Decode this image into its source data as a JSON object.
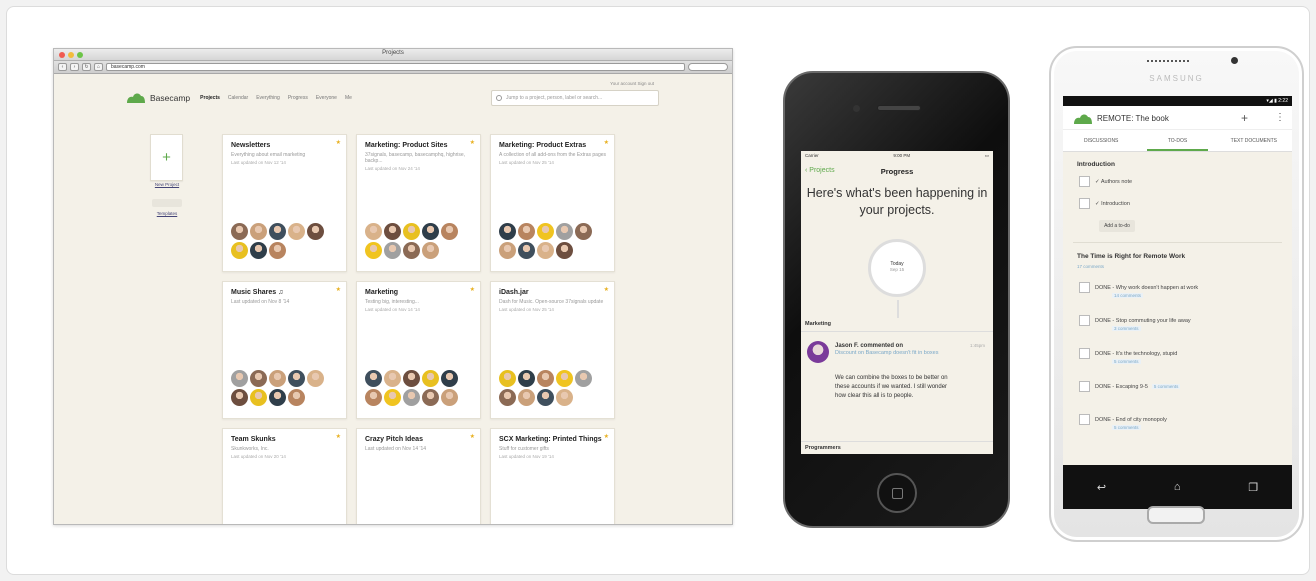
{
  "desktop": {
    "window_title": "Projects",
    "url": "basecamp.com",
    "top_links": "Your account   Sign out",
    "app_name": "Basecamp",
    "nav": [
      {
        "label": "Projects",
        "active": true
      },
      {
        "label": "Calendar",
        "active": false
      },
      {
        "label": "Everything",
        "active": false
      },
      {
        "label": "Progress",
        "active": false
      },
      {
        "label": "Everyone",
        "active": false
      },
      {
        "label": "Me",
        "active": false
      }
    ],
    "search_placeholder": "Jump to a project, person, label or search...",
    "new_project_label": "New Project",
    "templates_label": "Templates",
    "cards": [
      {
        "title": "Newsletters",
        "desc": "Everything about email marketing",
        "updated": "Last updated on Nov 12 '14",
        "avatars": 8
      },
      {
        "title": "Marketing: Product Sites",
        "desc": "37signals, basecamp, basecamphq, highrise, backp...",
        "updated": "Last updated on Nov 24 '14",
        "avatars": 9
      },
      {
        "title": "Marketing: Product Extras",
        "desc": "A collection of all add-ons from the Extras pages",
        "updated": "Last updated on Nov 25 '14",
        "avatars": 9
      },
      {
        "title": "Music Shares ♫",
        "desc": "Last updated on Nov 8 '14",
        "updated": "",
        "avatars": 9
      },
      {
        "title": "Marketing",
        "desc": "Testing big, interesting...",
        "updated": "Last updated on Nov 14 '14",
        "avatars": 10
      },
      {
        "title": "iDash.jar",
        "desc": "Dash for Music. Open-source 37signals update",
        "updated": "Last updated on Nov 25 '14",
        "avatars": 9
      },
      {
        "title": "Team Skunks",
        "desc": "Skunkworks, Inc.",
        "updated": "Last updated on Nov 20 '14",
        "avatars": 0
      },
      {
        "title": "Crazy Pitch Ideas",
        "desc": "Last updated on Nov 14 '14",
        "updated": "",
        "avatars": 0
      },
      {
        "title": "SCX Marketing: Printed Things",
        "desc": "Stuff for customer gifts",
        "updated": "Last updated on Nov 19 '14",
        "avatars": 0
      }
    ]
  },
  "iphone": {
    "carrier": "Carrier",
    "time": "9:00 PM",
    "back_label": "Projects",
    "title": "Progress",
    "headline": "Here's what's been happening in your projects.",
    "today_label": "Today",
    "today_date": "Sep 15",
    "section_1": "Marketing",
    "comment_author": "Jason F. commented on",
    "comment_time": "1:45pm",
    "comment_link": "Discount on Basecamp doesn't fit in boxes",
    "comment_body": "We can combine the boxes to be better on these accounts if we wanted. I still wonder how clear this all is to people.",
    "section_2": "Programmers"
  },
  "samsung": {
    "brand": "SAMSUNG",
    "time": "2:22",
    "title": "REMOTE: The book",
    "tabs": [
      {
        "label": "DISCUSSIONS",
        "active": false
      },
      {
        "label": "TO-DOS",
        "active": true
      },
      {
        "label": "TEXT DOCUMENTS",
        "active": false
      }
    ],
    "list_1_title": "Introduction",
    "list_1_items": [
      "Authors note",
      "Introduction"
    ],
    "add_todo_label": "Add a to-do",
    "list_2_title": "The Time is Right for Remote Work",
    "list_2_sub": "17 comments",
    "list_2_items": [
      {
        "label": "DONE - Why work doesn't happen at work",
        "sub": "14 comments"
      },
      {
        "label": "DONE - Stop commuting your life away",
        "sub": "3 comments"
      },
      {
        "label": "DONE - It's the technology, stupid",
        "sub": "5 comments"
      },
      {
        "label": "DONE - Escaping 9-5",
        "sub": "5 comments"
      },
      {
        "label": "DONE - End of city monopoly",
        "sub": "5 comments"
      }
    ]
  },
  "colors": {
    "accent_green": "#5ea94b",
    "link_blue": "#7aa8c8",
    "star_yellow": "#e8b020",
    "canvas_beige": "#f4f1e8"
  }
}
